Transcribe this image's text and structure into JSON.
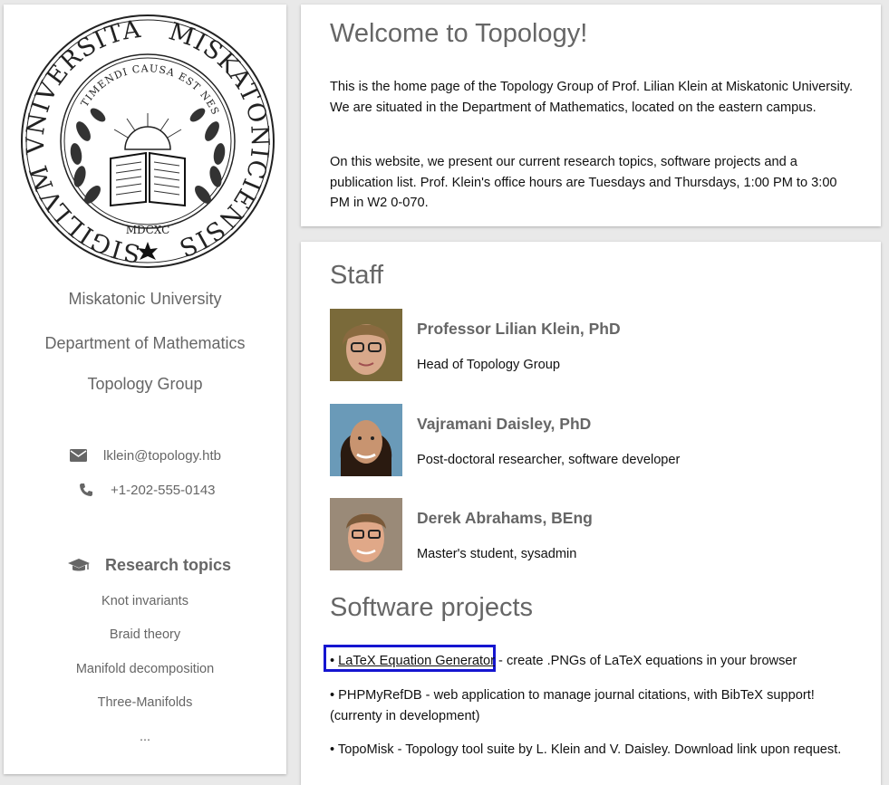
{
  "sidebar": {
    "seal": {
      "ring_text_left": "SIGILLVM VNIVERSITATIS",
      "ring_text_right": "MISKATONICIENSIS",
      "motto": "TIMENDI CAUSA EST NESCIRE",
      "year": "MDCXC"
    },
    "university": "Miskatonic University",
    "department": "Department of Mathematics",
    "group": "Topology Group",
    "email": "lklein@topology.htb",
    "phone": "+1-202-555-0143",
    "research_heading": "Research topics",
    "topics": [
      "Knot invariants",
      "Braid theory",
      "Manifold decomposition",
      "Three-Manifolds",
      "..."
    ]
  },
  "welcome": {
    "title": "Welcome to Topology!",
    "para1": "This is the home page of the Topology Group of Prof. Lilian Klein at Miskatonic University. We are situated in the Department of Mathematics, located on the eastern campus.",
    "para2": "On this website, we present our current research topics, software projects and a publication list. Prof. Klein's office hours are Tuesdays and Thursdays, 1:00 PM to 3:00 PM in W2 0-070."
  },
  "staff": {
    "title": "Staff",
    "members": [
      {
        "name": "Professor Lilian Klein, PhD",
        "role": "Head of Topology Group"
      },
      {
        "name": "Vajramani Daisley, PhD",
        "role": "Post-doctoral researcher, software developer"
      },
      {
        "name": "Derek Abrahams, BEng",
        "role": "Master's student, sysadmin"
      }
    ]
  },
  "software": {
    "title": "Software projects",
    "projects": [
      {
        "bullet": "• ",
        "link": "LaTeX Equation Generator",
        "desc": " - create .PNGs of LaTeX equations in your browser"
      },
      {
        "bullet": "• ",
        "text": "PHPMyRefDB - web application to manage journal citations, with BibTeX support! (currenty in development)"
      },
      {
        "bullet": "• ",
        "text": "TopoMisk - Topology tool suite by L. Klein and V. Daisley. Download link upon request."
      }
    ]
  },
  "colors": {
    "accent_highlight": "#1515d0",
    "heading_gray": "#666666"
  }
}
